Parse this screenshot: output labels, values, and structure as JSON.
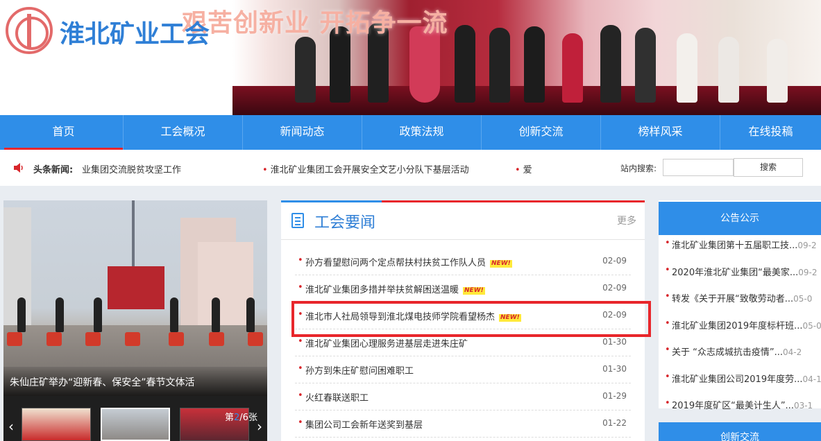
{
  "site": {
    "title": "淮北矿业工会",
    "slogan": "艰苦创新业 开拓争一流"
  },
  "nav": {
    "items": [
      {
        "label": "首页",
        "active": true
      },
      {
        "label": "工会概况"
      },
      {
        "label": "新闻动态"
      },
      {
        "label": "政策法规"
      },
      {
        "label": "创新交流"
      },
      {
        "label": "榜样风采"
      },
      {
        "label": "在线投稿"
      }
    ]
  },
  "ticker": {
    "label": "头条新闻:",
    "items": [
      "业集团交流脱贫攻坚工作",
      "淮北矿业集团工会开展安全文艺小分队下基层活动",
      "爱"
    ]
  },
  "search": {
    "label": "站内搜索:",
    "value": "",
    "button": "搜索"
  },
  "slideshow": {
    "caption": "朱仙庄矿举办“迎新春、保安全”春节文体活",
    "counter_prefix": "第",
    "counter_current": "2",
    "counter_suffix": "/6张"
  },
  "news": {
    "title": "工会要闻",
    "more": "更多",
    "new_badge": "NEW!",
    "items": [
      {
        "title": "孙方看望慰问两个定点帮扶村扶贫工作队人员",
        "date": "02-09",
        "new": true
      },
      {
        "title": "淮北矿业集团多措并举扶贫解困送温暖",
        "date": "02-09",
        "new": true
      },
      {
        "title": "淮北市人社局领导到淮北煤电技师学院看望杨杰",
        "date": "02-09",
        "new": true
      },
      {
        "title": "淮北矿业集团心理服务进基层走进朱庄矿",
        "date": "01-30",
        "new": false
      },
      {
        "title": "孙方到朱庄矿慰问困难职工",
        "date": "01-30",
        "new": false
      },
      {
        "title": "火红春联送职工",
        "date": "01-29",
        "new": false
      },
      {
        "title": "集团公司工会新年送奖到基层",
        "date": "01-22",
        "new": false
      }
    ]
  },
  "notices": {
    "title": "公告公示",
    "items": [
      {
        "title": "淮北矿业集团第十五届职工技...",
        "date": "09-2"
      },
      {
        "title": "2020年淮北矿业集团“最美家...",
        "date": "09-2"
      },
      {
        "title": "转发《关于开展“致敬劳动者...",
        "date": "05-0"
      },
      {
        "title": "淮北矿业集团2019年度标杆班...",
        "date": "05-0"
      },
      {
        "title": "关于 “众志成城抗击疫情”...",
        "date": "04-2"
      },
      {
        "title": "淮北矿业集团公司2019年度劳...",
        "date": "04-1"
      },
      {
        "title": "2019年度矿区“最美计生人”...",
        "date": "03-1"
      }
    ]
  },
  "innovation": {
    "title": "创新交流"
  },
  "colors": {
    "primary": "#2f8ee8",
    "accent_red": "#e8262b",
    "title_blue": "#2f7fd6"
  }
}
